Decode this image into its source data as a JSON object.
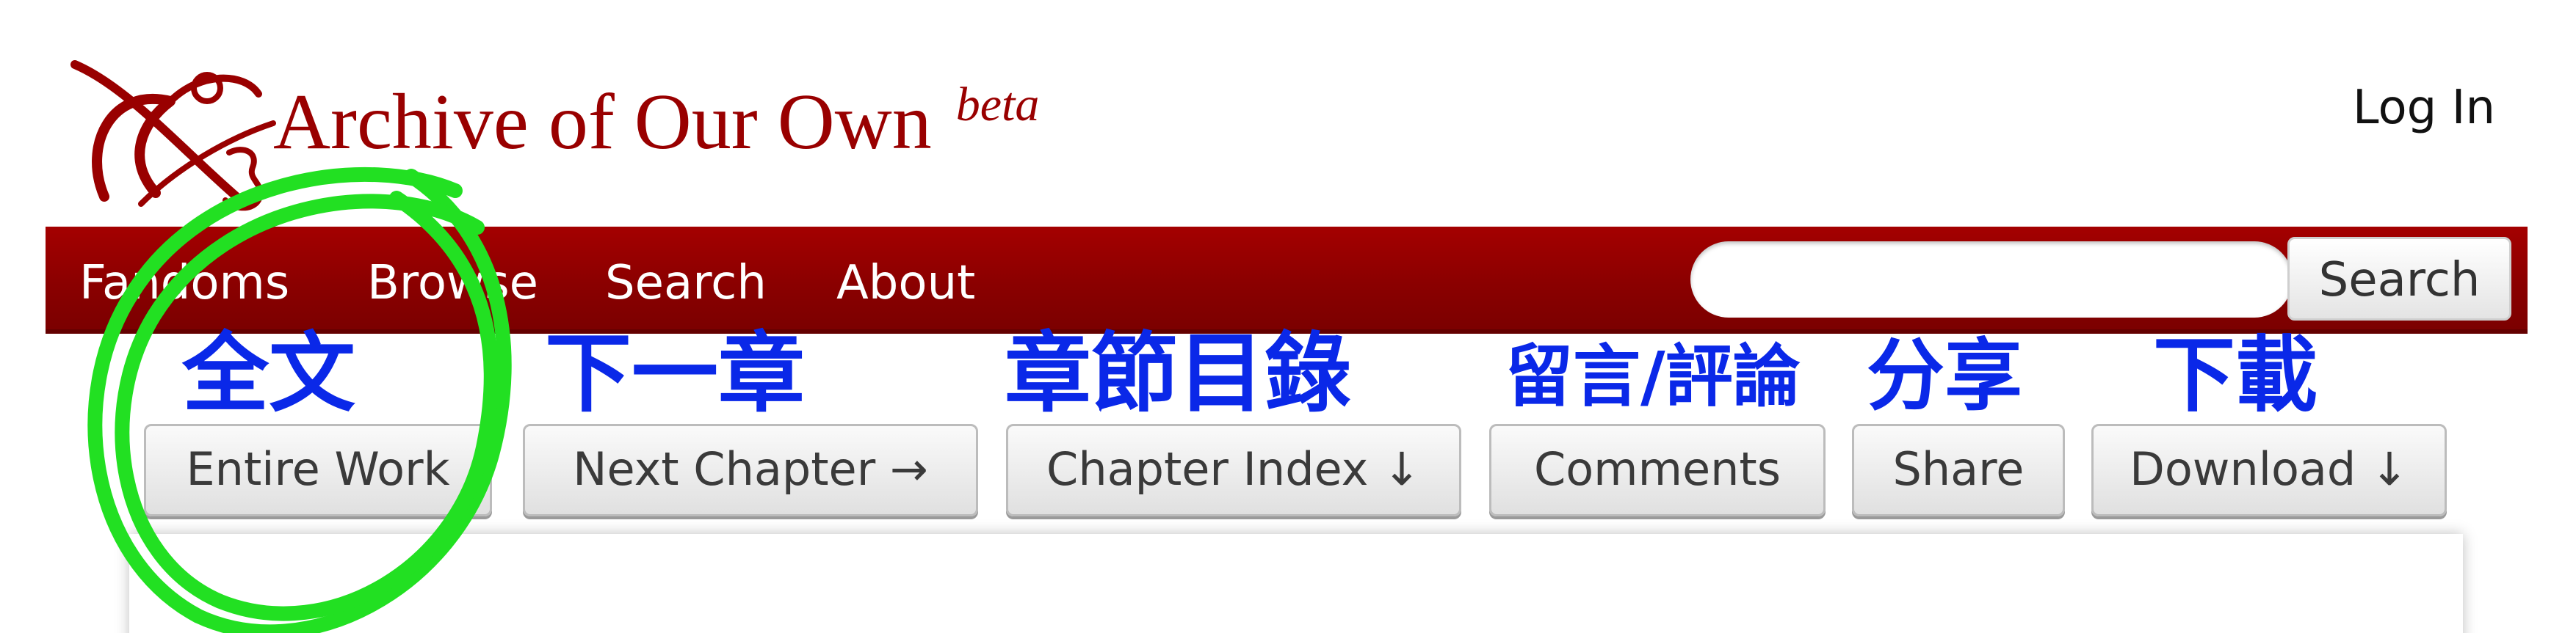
{
  "header": {
    "site_title": "Archive of Our Own",
    "beta_label": "beta",
    "login_label": "Log In"
  },
  "nav": {
    "items": [
      "Fandoms",
      "Browse",
      "Search",
      "About"
    ],
    "search_button_label": "Search"
  },
  "annotations": {
    "entire_work": "全文",
    "next_chapter": "下一章",
    "chapter_index": "章節目錄",
    "comments": "留言/評論",
    "share": "分享",
    "download": "下載"
  },
  "actions": {
    "entire_work": "Entire Work",
    "next_chapter": "Next Chapter →",
    "chapter_index": "Chapter Index ↓",
    "comments": "Comments",
    "share": "Share",
    "download": "Download ↓"
  },
  "colors": {
    "brand": "#990000",
    "nav_bg": "#8a0000",
    "annotation": "#0a28e8",
    "highlight_circle": "#22e022"
  },
  "icons": {
    "logo": "ao3-logo-icon"
  }
}
